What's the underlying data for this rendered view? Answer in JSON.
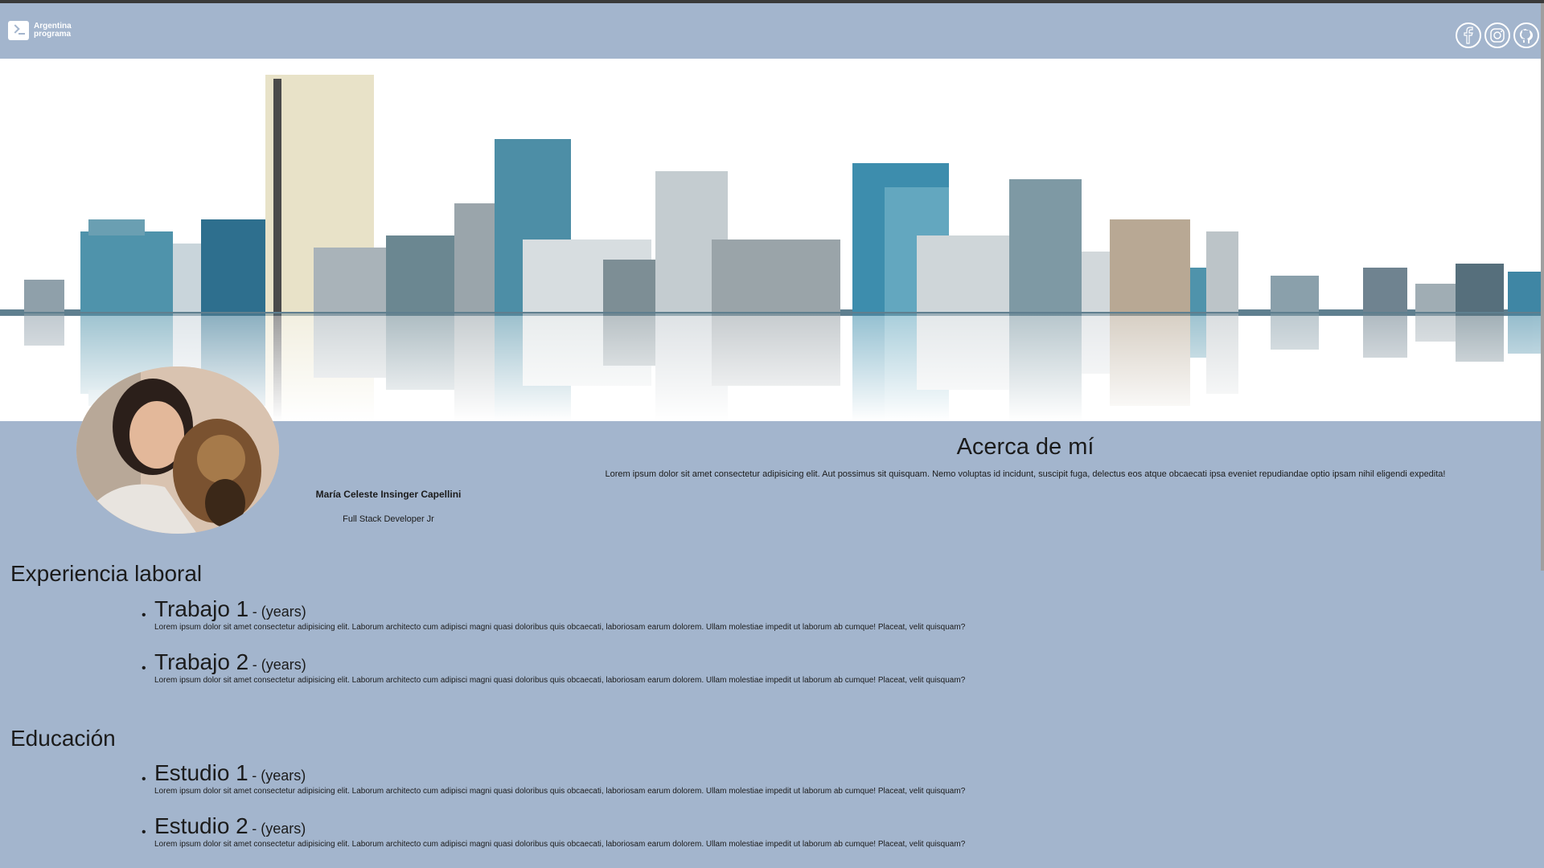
{
  "header": {
    "brand_text": "Argentina programa",
    "social_icons": [
      "facebook-icon",
      "instagram-icon",
      "github-icon"
    ]
  },
  "profile": {
    "name": "María Celeste Insinger Capellini",
    "role": "Full Stack Developer Jr"
  },
  "about": {
    "title": "Acerca de mí",
    "text": "Lorem ipsum dolor sit amet consectetur adipisicing elit. Aut possimus sit quisquam. Nemo voluptas id incidunt, suscipit fuga, delectus eos atque obcaecati ipsa eveniet repudiandae optio ipsam nihil eligendi expedita!"
  },
  "experience": {
    "title": "Experiencia laboral",
    "items": [
      {
        "title": "Trabajo 1",
        "years": "- (years)",
        "desc": "Lorem ipsum dolor sit amet consectetur adipisicing elit. Laborum architecto cum adipisci magni quasi doloribus quis obcaecati, laboriosam earum dolorem. Ullam molestiae impedit ut laborum ab cumque! Placeat, velit quisquam?"
      },
      {
        "title": "Trabajo 2",
        "years": "- (years)",
        "desc": "Lorem ipsum dolor sit amet consectetur adipisicing elit. Laborum architecto cum adipisci magni quasi doloribus quis obcaecati, laboriosam earum dolorem. Ullam molestiae impedit ut laborum ab cumque! Placeat, velit quisquam?"
      }
    ]
  },
  "education": {
    "title": "Educación",
    "items": [
      {
        "title": "Estudio 1",
        "years": "- (years)",
        "desc": "Lorem ipsum dolor sit amet consectetur adipisicing elit. Laborum architecto cum adipisci magni quasi doloribus quis obcaecati, laboriosam earum dolorem. Ullam molestiae impedit ut laborum ab cumque! Placeat, velit quisquam?"
      },
      {
        "title": "Estudio 2",
        "years": "- (years)",
        "desc": "Lorem ipsum dolor sit amet consectetur adipisicing elit. Laborum architecto cum adipisci magni quasi doloribus quis obcaecati, laboriosam earum dolorem. Ullam molestiae impedit ut laborum ab cumque! Placeat, velit quisquam?"
      }
    ]
  }
}
